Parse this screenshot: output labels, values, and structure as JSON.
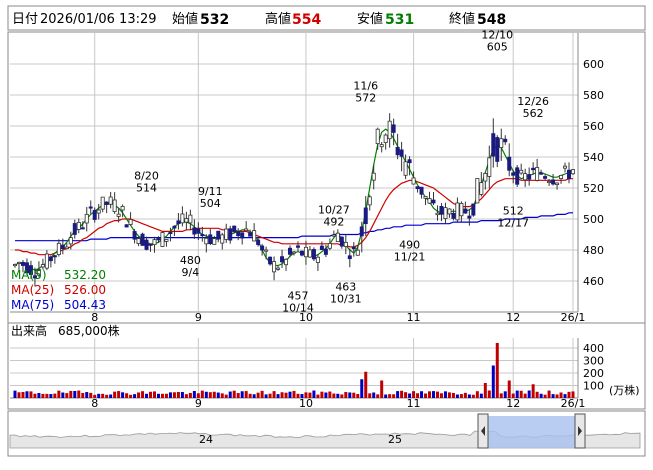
{
  "header": {
    "date_label": "日付",
    "datetime": "2026/01/06 13:29",
    "open_label": "始値",
    "open_value": "532",
    "high_label": "高値",
    "high_value": "554",
    "low_label": "安値",
    "low_value": "531",
    "close_label": "終値",
    "close_value": "548"
  },
  "colors": {
    "up": "#c00000",
    "down": "#0000c0",
    "candle_down": "#1a1a80",
    "ma5": "#008000",
    "ma25": "#d00000",
    "ma75": "#0000d0",
    "high_value": "#d00000",
    "low_value": "#008000",
    "grid": "#c8c8c8",
    "navigator_fill": "#a8c0f0"
  },
  "legend": {
    "ma5_label": "MA(5)",
    "ma5_value": "532.20",
    "ma25_label": "MA(25)",
    "ma25_value": "526.00",
    "ma75_label": "MA(75)",
    "ma75_value": "504.43"
  },
  "volume_panel": {
    "label": "出来高",
    "value": "685,000株",
    "unit": "(万株)"
  },
  "navigator": {
    "labels": [
      "24",
      "25"
    ]
  },
  "chart_data": [
    {
      "type": "candlestick",
      "x_axis": {
        "tick_labels": [
          "8",
          "9",
          "10",
          "11",
          "12",
          "26/1"
        ]
      },
      "y_axis": {
        "ylim": [
          440,
          620
        ],
        "tick_labels": [
          "460",
          "480",
          "500",
          "520",
          "540",
          "560",
          "580",
          "600"
        ]
      },
      "series": [
        {
          "name": "MA(5)",
          "value": 532.2
        },
        {
          "name": "MA(25)",
          "value": 526.0
        },
        {
          "name": "MA(75)",
          "value": 504.43
        }
      ],
      "annotations": [
        {
          "date": "8/20",
          "value": "514"
        },
        {
          "date": "9/11",
          "value": "504"
        },
        {
          "date": "9/4",
          "value": "480"
        },
        {
          "date": "10/27",
          "value": "492"
        },
        {
          "date": "10/14",
          "value": "457"
        },
        {
          "date": "10/31",
          "value": "463"
        },
        {
          "date": "11/6",
          "value": "572"
        },
        {
          "date": "11/21",
          "value": "490"
        },
        {
          "date": "12/10",
          "value": "605"
        },
        {
          "date": "12/26",
          "value": "562"
        },
        {
          "date": "12/17",
          "value": "512"
        }
      ],
      "ma5": [
        470,
        472,
        471,
        470,
        468,
        467,
        468,
        470,
        472,
        475,
        478,
        480,
        482,
        485,
        489,
        492,
        494,
        497,
        500,
        503,
        505,
        507,
        509,
        510,
        510,
        509,
        507,
        504,
        500,
        496,
        492,
        489,
        487,
        485,
        484,
        484,
        485,
        487,
        489,
        492,
        495,
        497,
        498,
        498,
        497,
        495,
        492,
        490,
        489,
        488,
        487,
        487,
        488,
        489,
        490,
        491,
        492,
        493,
        493,
        492,
        490,
        486,
        480,
        475,
        472,
        470,
        470,
        471,
        473,
        476,
        478,
        479,
        478,
        477,
        476,
        476,
        477,
        479,
        481,
        484,
        488,
        491,
        487,
        483,
        480,
        478,
        482,
        492,
        505,
        520,
        535,
        548,
        556,
        558,
        556,
        552,
        547,
        542,
        537,
        532,
        527,
        522,
        518,
        514,
        511,
        507,
        505,
        504,
        504,
        505,
        505,
        505,
        505,
        505,
        506,
        508,
        515,
        522,
        530,
        538,
        545,
        548,
        546,
        541,
        536,
        531,
        528,
        526,
        527,
        528,
        529,
        530,
        530,
        529,
        528,
        527,
        527,
        528,
        529,
        530,
        532
      ],
      "ma25": [
        480,
        480,
        479,
        479,
        478,
        478,
        477,
        477,
        477,
        477,
        478,
        479,
        480,
        481,
        482,
        484,
        485,
        487,
        488,
        490,
        492,
        494,
        495,
        497,
        498,
        499,
        499,
        500,
        500,
        500,
        499,
        498,
        497,
        496,
        495,
        494,
        493,
        492,
        492,
        492,
        492,
        492,
        492,
        493,
        493,
        494,
        494,
        494,
        494,
        494,
        494,
        494,
        493,
        493,
        493,
        493,
        492,
        492,
        492,
        491,
        490,
        489,
        488,
        487,
        486,
        485,
        485,
        484,
        484,
        484,
        484,
        484,
        484,
        484,
        484,
        484,
        484,
        484,
        484,
        484,
        484,
        484,
        483,
        483,
        482,
        482,
        483,
        485,
        488,
        492,
        497,
        502,
        507,
        512,
        516,
        519,
        521,
        523,
        524,
        525,
        525,
        524,
        523,
        522,
        521,
        520,
        518,
        516,
        514,
        512,
        510,
        509,
        508,
        508,
        508,
        509,
        511,
        513,
        516,
        519,
        522,
        524,
        525,
        526,
        526,
        526,
        526,
        525,
        525,
        525,
        525,
        525,
        525,
        525,
        525,
        525,
        525,
        525,
        525,
        526,
        526
      ],
      "ma75": [
        486,
        486,
        486,
        486,
        486,
        486,
        486,
        486,
        486,
        486,
        486,
        486,
        486,
        486,
        486,
        486,
        486,
        486,
        486,
        487,
        487,
        487,
        487,
        487,
        488,
        488,
        488,
        488,
        488,
        488,
        488,
        488,
        488,
        488,
        488,
        488,
        488,
        488,
        488,
        488,
        488,
        488,
        488,
        488,
        488,
        488,
        488,
        488,
        488,
        488,
        488,
        488,
        488,
        488,
        488,
        488,
        488,
        488,
        488,
        488,
        488,
        488,
        488,
        488,
        488,
        488,
        488,
        488,
        488,
        488,
        488,
        488,
        489,
        489,
        489,
        489,
        489,
        489,
        489,
        489,
        490,
        490,
        490,
        490,
        490,
        490,
        490,
        491,
        491,
        492,
        492,
        493,
        493,
        494,
        494,
        495,
        495,
        495,
        496,
        496,
        496,
        496,
        496,
        497,
        497,
        497,
        497,
        497,
        497,
        497,
        498,
        498,
        498,
        498,
        498,
        498,
        498,
        499,
        499,
        499,
        499,
        499,
        499,
        500,
        500,
        500,
        500,
        500,
        501,
        501,
        501,
        501,
        502,
        502,
        502,
        502,
        503,
        503,
        503,
        504,
        504
      ]
    }
  ]
}
